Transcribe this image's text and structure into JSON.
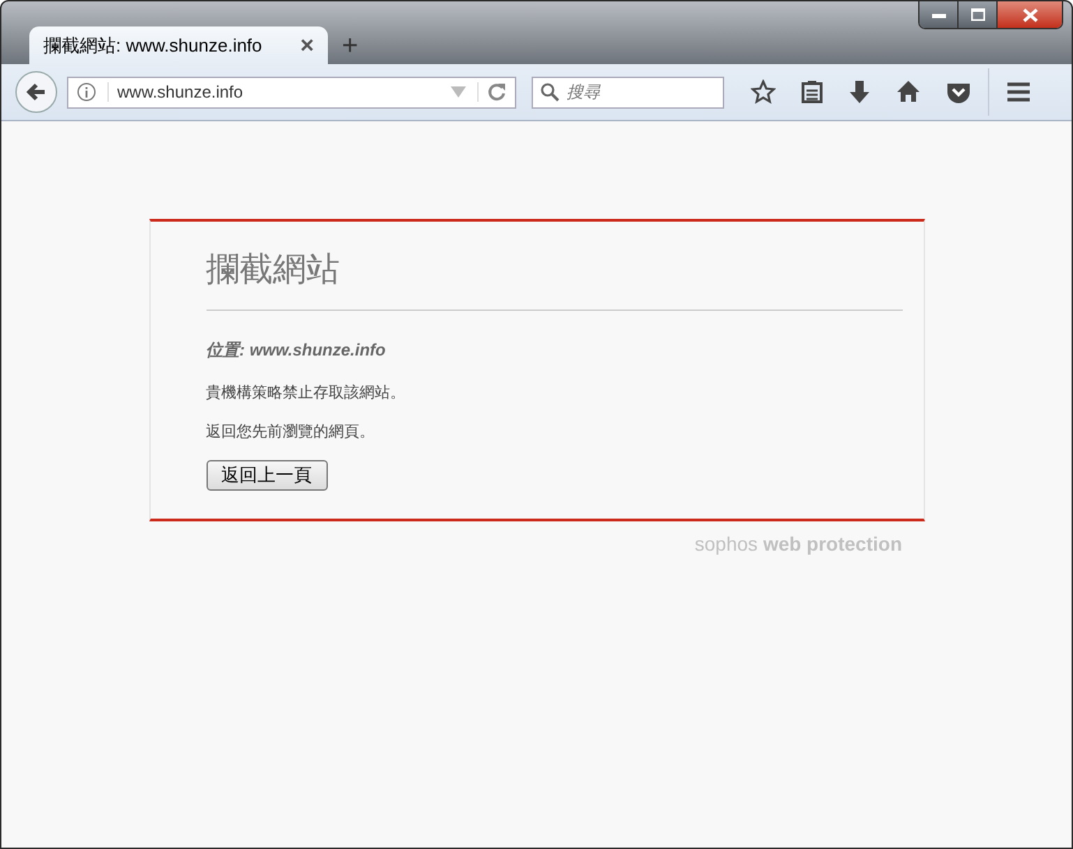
{
  "tab": {
    "title": "攔截網站: www.shunze.info",
    "close": "×",
    "new_tab": "+"
  },
  "address_bar": {
    "url": "www.shunze.info"
  },
  "search": {
    "placeholder": "搜尋"
  },
  "page": {
    "title": "攔截網站",
    "location": "位置: www.shunze.info",
    "message": "貴機構策略禁止存取該網站。",
    "hint": "返回您先前瀏覽的網頁。",
    "button": "返回上一頁",
    "footer": "sophos **web protection**"
  }
}
